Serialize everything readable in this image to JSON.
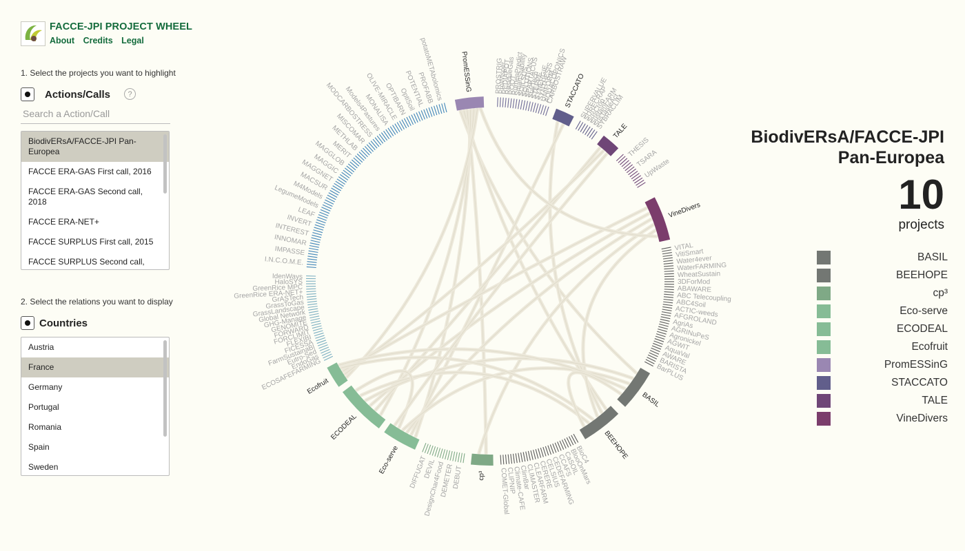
{
  "app": {
    "title": "FACCE-JPI PROJECT WHEEL",
    "nav": [
      "About",
      "Credits",
      "Legal"
    ]
  },
  "step1": {
    "label": "1. Select the projects you want to highlight",
    "group": "Actions/Calls",
    "help_icon": "question-mark-icon",
    "search_placeholder": "Search a Action/Call",
    "items": [
      {
        "label": "BiodivERsA/FACCE-JPI Pan-Europea",
        "selected": true
      },
      {
        "label": "FACCE ERA-GAS First call, 2016",
        "selected": false
      },
      {
        "label": "FACCE ERA-GAS Second call, 2018",
        "selected": false
      },
      {
        "label": "FACCE ERA-NET+",
        "selected": false
      },
      {
        "label": "FACCE SURPLUS First call, 2015",
        "selected": false
      },
      {
        "label": "FACCE SURPLUS Second call,",
        "selected": false
      }
    ]
  },
  "step2": {
    "label": "2. Select the relations you want to display",
    "group": "Countries",
    "items": [
      {
        "label": "Austria",
        "selected": false
      },
      {
        "label": "France",
        "selected": true
      },
      {
        "label": "Germany",
        "selected": false
      },
      {
        "label": "Portugal",
        "selected": false
      },
      {
        "label": "Romania",
        "selected": false
      },
      {
        "label": "Spain",
        "selected": false
      },
      {
        "label": "Sweden",
        "selected": false
      }
    ]
  },
  "summary": {
    "selected_title": "BiodivERsA/FACCE-JPI Pan-Europea",
    "count": "10",
    "count_label": "projects"
  },
  "legend": [
    {
      "name": "BASIL",
      "color": "#737773"
    },
    {
      "name": "BEEHOPE",
      "color": "#737773"
    },
    {
      "name": "cp³",
      "color": "#7fa986"
    },
    {
      "name": "Eco-serve",
      "color": "#86bc96"
    },
    {
      "name": "ECODEAL",
      "color": "#86bc96"
    },
    {
      "name": "Ecofruit",
      "color": "#86bc96"
    },
    {
      "name": "PromESSinG",
      "color": "#9a87b2"
    },
    {
      "name": "STACCATO",
      "color": "#615e8b"
    },
    {
      "name": "TALE",
      "color": "#6f4677"
    },
    {
      "name": "VineDivers",
      "color": "#7b3d6c"
    }
  ],
  "wheel": {
    "highlighted": [
      {
        "name": "PromESSinG",
        "color": "#9a87b2",
        "a0": 349,
        "a1": 358
      },
      {
        "name": "STACCATO",
        "color": "#615e8b",
        "a0": 21,
        "a1": 27
      },
      {
        "name": "TALE",
        "color": "#6f4677",
        "a0": 38,
        "a1": 44
      },
      {
        "name": "VineDivers",
        "color": "#7b3d6c",
        "a0": 63,
        "a1": 77
      },
      {
        "name": "BASIL",
        "color": "#737773",
        "a0": 120,
        "a1": 133
      },
      {
        "name": "BEEHOPE",
        "color": "#737773",
        "a0": 136,
        "a1": 149
      },
      {
        "name": "cp³",
        "color": "#7fa986",
        "a0": 179,
        "a1": 186
      },
      {
        "name": "Eco-serve",
        "color": "#86bc96",
        "a0": 204,
        "a1": 215
      },
      {
        "name": "ECODEAL",
        "color": "#86bc96",
        "a0": 217,
        "a1": 233
      },
      {
        "name": "Ecofruit",
        "color": "#86bc96",
        "a0": 235,
        "a1": 242
      }
    ],
    "other_groups": [
      {
        "a0": 2,
        "a1": 19,
        "color": "#6e6a96",
        "labels": [
          "PROSTRIG",
          "ProWisper",
          "REDIAPOT",
          "ResidueGas",
          "ROOT",
          "RumenPredict",
          "SmartStability",
          "SOILSUS",
          "SOLUTIONS",
          "SPARTACUS",
          "StarTech",
          "STEPPE",
          "SYNERGIE",
          "SYNTHESIS",
          "UNIFORM",
          "AQUACOPONICS",
          "CARBOSTRAW"
        ]
      },
      {
        "a0": 29,
        "a1": 36,
        "color": "#615e8b",
        "labels": [
          "SUPERVALUE",
          "SURECRAP",
          "SusCrop",
          "SustainFARM",
          "SusTasteAct",
          "SYBRACLIM"
        ]
      },
      {
        "a0": 46,
        "a1": 58,
        "color": "#6f4677",
        "labels": [
          "THESIS",
          "TSARA",
          "UpWaste"
        ]
      },
      {
        "a0": 79,
        "a1": 118,
        "color": "#5a5a5a",
        "labels": [
          "VITAL",
          "VitiSmart",
          "Water4ever",
          "WaterFARMING",
          "WheatSustain",
          "3DForMod",
          "ABAWARE",
          "ABC Telecoupling",
          "ABC4Soil",
          "ACTIC-weeds",
          "AFGROLAND",
          "AgriAs",
          "AGRINuPeS",
          "Agronickel",
          "AGWIT",
          "AquaVal",
          "AWARE",
          "BARISTA",
          "BarPLUS"
        ]
      },
      {
        "a0": 151,
        "a1": 177,
        "color": "#5a5a5a",
        "labels": [
          "BioC4",
          "BlooOnMars",
          "CaSOIL",
          "CCAFS",
          "CEDEFARMING",
          "CELSIUS",
          "CERERE",
          "CLEARFARM",
          "CLIMASTER",
          "ClimBar",
          "Climate-CAFE",
          "CLIPNIP",
          "COMET-Global"
        ]
      },
      {
        "a0": 188,
        "a1": 202,
        "color": "#7fa986",
        "labels": [
          "DEBUT",
          "DEMETER",
          "DesignChar4Food",
          "DEVIL",
          "DIFFUGAT"
        ]
      },
      {
        "a0": 244,
        "a1": 272,
        "color": "#7aaec0",
        "labels": [
          "ECOSAFEFARMING",
          "EndoGas",
          "Eutro-Sed",
          "FarmSustainaBl",
          "FICESSA",
          "FLEXIBI",
          "FORCLIMIT",
          "FORWARD",
          "GENOMITE",
          "GHG-Manage",
          "Global Network",
          "GrassLandscape",
          "GrassToGas",
          "GrASTech",
          "GreenRice ERA-NET+",
          "GreenRice MPC",
          "HaloSYS",
          "IdenWays"
        ]
      },
      {
        "a0": 274,
        "a1": 346,
        "color": "#3f84b8",
        "labels": [
          "I.N.C.O.M.E.",
          "IMPASSE",
          "INNOMAR",
          "INTEREST",
          "INVERT",
          "LEAF",
          "LegumeModels",
          "M4Models",
          "MACSUR",
          "MAGGNET",
          "MAGGIC",
          "MAGGLOB",
          "MERIT",
          "METHLAB",
          "MISCOMAR",
          "MODCARBOSTRESS",
          "Models4Pastures",
          "MONALISA",
          "OLIVE-MIRACLE",
          "OPTIBARN",
          "OptiSoil",
          "POTENTIAL",
          "PROFABB",
          "potatoMETAbolomics"
        ]
      }
    ],
    "node_labels": [
      "PROSTRIG",
      "ProWisper",
      "REDIAPOT",
      "ResidueGas",
      "ROOT",
      "RumenPredict",
      "SmartStability",
      "SOILSUS",
      "SOLUTIONS",
      "SPARTACUS",
      "StarTech",
      "AQUACOPONICS",
      "CARBOSTRAW",
      "SUPERVALUE",
      "SURECRAP",
      "SusCrop",
      "SustainFARM",
      "SusTasteAct",
      "SYBRACLIM",
      "THESIS",
      "TSARA",
      "UpWaste",
      "VITAL",
      "VitiSmart",
      "Water4ever",
      "WaterFARMING",
      "WheatSustain",
      "3DForMod",
      "ABAWARE",
      "ABC Telecoupling",
      "ABC4Soil",
      "ACTIC-weeds",
      "AFGROLAND",
      "AgriAs",
      "AGRINuPeS",
      "Agronickel",
      "AGWIT",
      "AquaVal",
      "AWARE",
      "BARISTA",
      "BarPLUS",
      "BioC4",
      "BlooOnMars",
      "CaSOIL",
      "CCAFS",
      "CEDEFARMING",
      "CELSIUS",
      "CERERE",
      "CLEARFARM",
      "CLIMASTER",
      "ClimBar",
      "Climate-CAFE",
      "CLIPNIP",
      "COMET-Global",
      "DEBUT",
      "DEMETER",
      "DesignChar4Food",
      "DEVIL",
      "DIFFUGAT",
      "ECOSAFEFARMING",
      "EndoGas",
      "Eutro-Sed",
      "FarmSustainaBl",
      "FICESSA",
      "FLEXIBI",
      "FORCLIMIT",
      "FORWARD",
      "GENOMITE",
      "GHG-Manage",
      "Global Network",
      "GrassLandscape",
      "GrassToGas",
      "GrASTech",
      "GreenRice ERA-NET+",
      "GreenRice MPC",
      "HaloSYS",
      "IdenWays",
      "I.N.C.O.M.E.",
      "IMPASSE",
      "INNOMAR",
      "INTEREST",
      "INVERT",
      "LEAF",
      "LegumeModels",
      "M4Models",
      "MACSUR",
      "MAGGNET",
      "MAGGIC",
      "MAGGLOB",
      "MERIT",
      "METHLAB",
      "MISCOMAR",
      "MODCARBOSTRESS",
      "Models4Pastures",
      "MONALISA",
      "OLIVE-MIRACLE",
      "OPTIBARN",
      "OptiSoil",
      "POTENTIAL",
      "PROFABB",
      "potatoMETAbolomics"
    ],
    "links": [
      [
        "PromESSinG",
        "BASIL"
      ],
      [
        "PromESSinG",
        "BEEHOPE"
      ],
      [
        "PromESSinG",
        "cp³"
      ],
      [
        "PromESSinG",
        "Eco-serve"
      ],
      [
        "PromESSinG",
        "ECODEAL"
      ],
      [
        "PromESSinG",
        "Ecofruit"
      ],
      [
        "STACCATO",
        "BEEHOPE"
      ],
      [
        "STACCATO",
        "Eco-serve"
      ],
      [
        "TALE",
        "ECODEAL"
      ],
      [
        "TALE",
        "Ecofruit"
      ],
      [
        "VineDivers",
        "Ecofruit"
      ],
      [
        "VineDivers",
        "ECODEAL"
      ],
      [
        "VineDivers",
        "Eco-serve"
      ],
      [
        "VineDivers",
        "cp³"
      ],
      [
        "VineDivers",
        "BEEHOPE"
      ],
      [
        "BASIL",
        "ECODEAL"
      ],
      [
        "BASIL",
        "Eco-serve"
      ],
      [
        "BEEHOPE",
        "Ecofruit"
      ],
      [
        "BEEHOPE",
        "ECODEAL"
      ],
      [
        "BASIL",
        "Ecofruit"
      ],
      [
        "Eco-serve",
        "ECODEAL"
      ],
      [
        "BASIL",
        "BEEHOPE"
      ],
      [
        "PromESSinG",
        "VineDivers"
      ],
      [
        "TALE",
        "Eco-serve"
      ]
    ]
  }
}
